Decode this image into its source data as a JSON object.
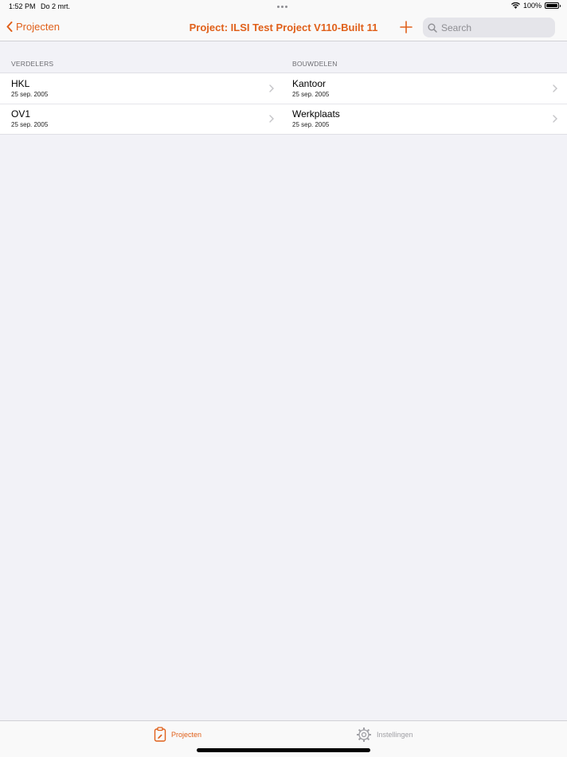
{
  "status": {
    "time": "1:52 PM",
    "date": "Do 2 mrt.",
    "battery": "100%",
    "battery_level": 1.0
  },
  "nav": {
    "back_label": "Projecten",
    "title": "Project: ILSI Test Project V110-Built 11",
    "search_placeholder": "Search"
  },
  "sections": [
    {
      "header": "VERDELERS",
      "items": [
        {
          "title": "HKL",
          "date": "25 sep. 2005"
        },
        {
          "title": "OV1",
          "date": "25 sep. 2005"
        }
      ]
    },
    {
      "header": "BOUWDELEN",
      "items": [
        {
          "title": "Kantoor",
          "date": "25 sep. 2005"
        },
        {
          "title": "Werkplaats",
          "date": "25 sep. 2005"
        }
      ]
    }
  ],
  "tabs": {
    "projecten": "Projecten",
    "instellingen": "Instellingen"
  },
  "colors": {
    "accent": "#e0601a",
    "background": "#f2f2f7",
    "inactive": "#a0a0a5"
  },
  "icons": [
    "chevron-left-icon",
    "plus-icon",
    "search-icon",
    "chevron-right-icon",
    "clipboard-icon",
    "gear-icon",
    "wifi-icon",
    "battery-icon"
  ]
}
